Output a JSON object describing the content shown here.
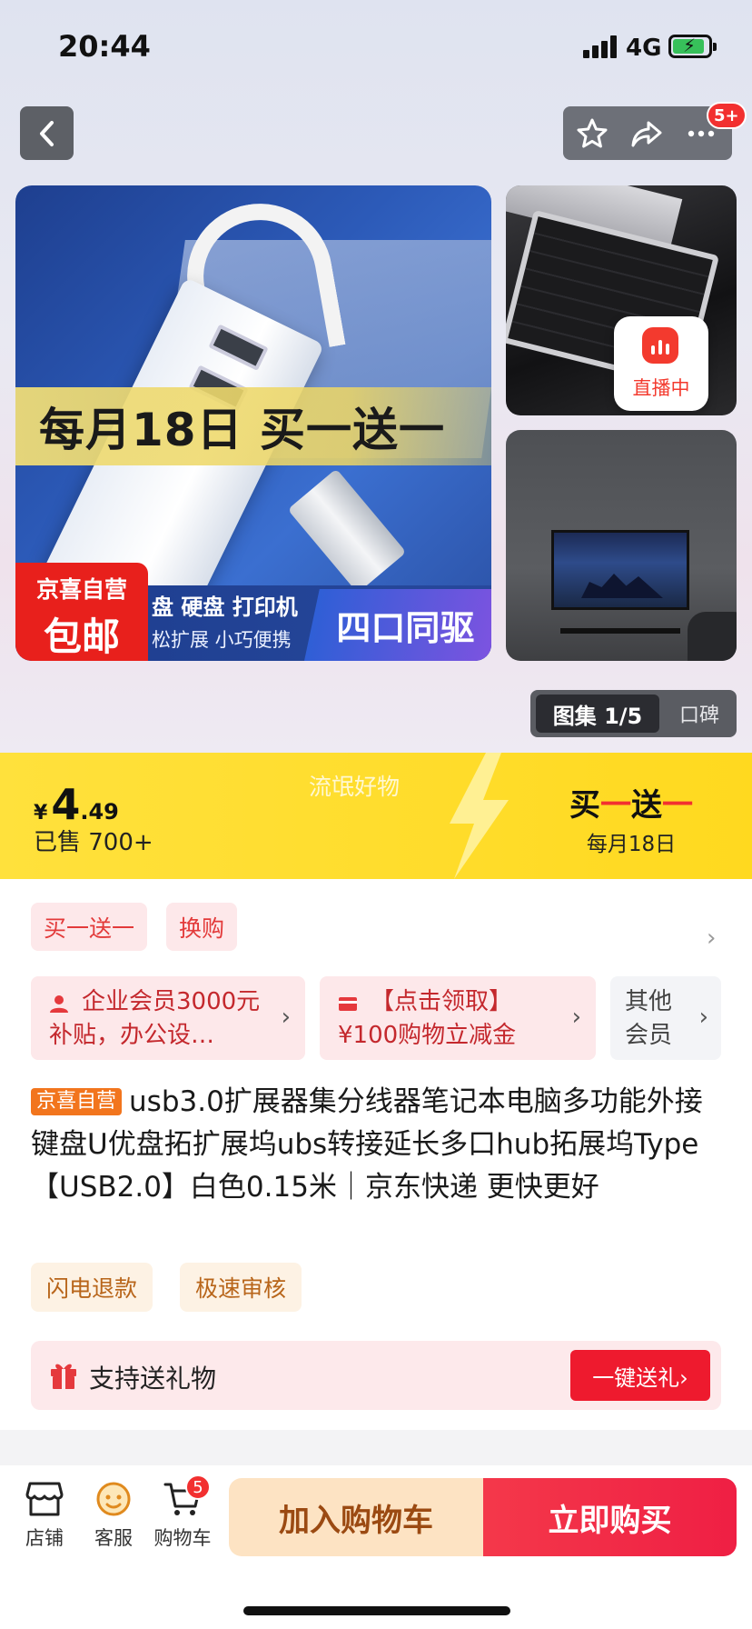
{
  "status_bar": {
    "time": "20:44",
    "network": "4G"
  },
  "nav": {
    "more_badge": "5+"
  },
  "main_image": {
    "promo_text": "每月18日 买一送一",
    "corner_line1": "京喜自营",
    "corner_line2": "包邮",
    "strip_line1": "盘  硬盘  打印机",
    "strip_line2": "松扩展  小巧便携",
    "feature": "四口同驱"
  },
  "live": {
    "label": "直播中"
  },
  "gallery": {
    "active": "图集 1/5",
    "inactive": "口碑"
  },
  "price": {
    "symbol": "¥",
    "integer": "4",
    "decimal": ".49",
    "sold": "已售 700+",
    "slogan": "流氓好物",
    "promo_title_a": "买",
    "promo_title_b": "一",
    "promo_title_c": "送",
    "promo_title_d": "一",
    "promo_sub": "每月18日"
  },
  "tags": [
    "买一送一",
    "换购"
  ],
  "coupons": [
    {
      "text": "企业会员3000元补贴，办公设…"
    },
    {
      "text": "【点击领取】¥100购物立减金"
    }
  ],
  "other_vip": "其他会员",
  "product": {
    "badge": "京喜自营",
    "title": "usb3.0扩展器集分线器笔记本电脑多功能外接键盘U优盘拓扩展坞ubs转接延长多口hub拓展坞Type 【USB2.0】白色0.15米｜京东快递 更快更好"
  },
  "services": [
    "闪电退款",
    "极速审核"
  ],
  "gift": {
    "text": "支持送礼物",
    "button": "一键送礼›"
  },
  "bottom_bar": {
    "store": "店铺",
    "service": "客服",
    "cart": "购物车",
    "cart_count": "5",
    "add_to_cart": "加入购物车",
    "buy_now": "立即购买"
  },
  "colors": {
    "accent": "#f23030",
    "price_band": "#ffdd2b",
    "buy": "#ef1f44"
  }
}
